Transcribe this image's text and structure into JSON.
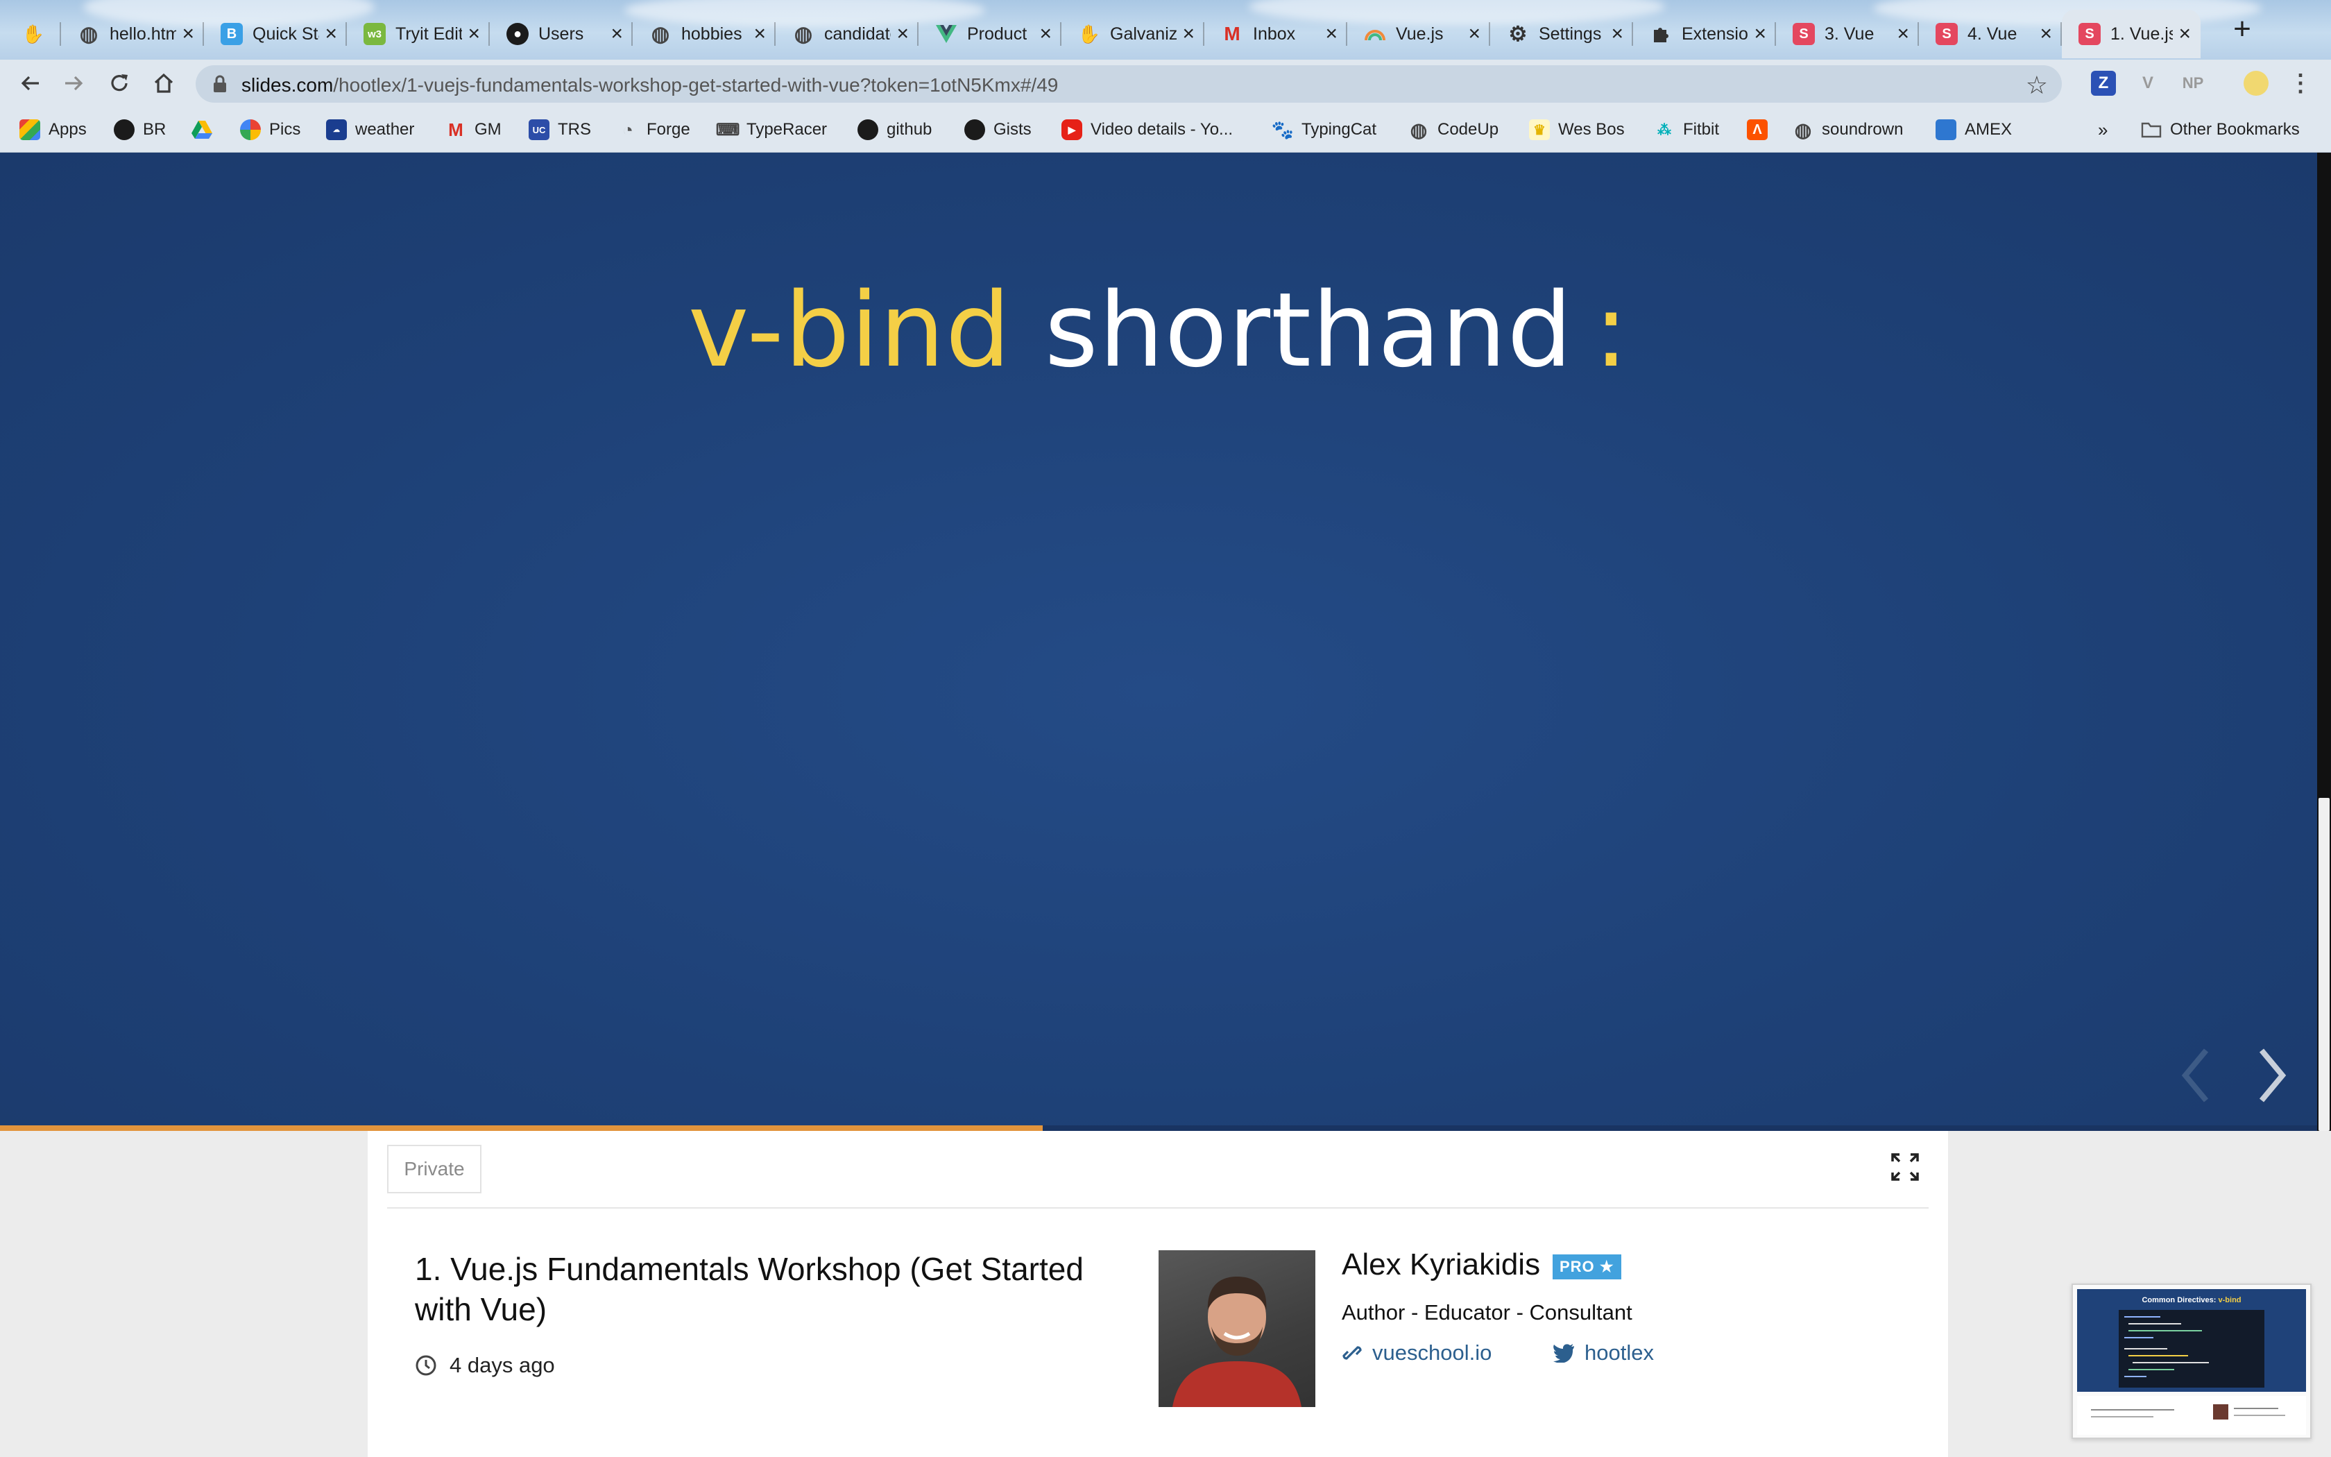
{
  "browser": {
    "tabs": [
      {
        "title": "",
        "icon": "galvanize-hand-icon",
        "color": "#e8a23c"
      },
      {
        "title": "hello.html",
        "icon": "globe-icon",
        "color": "#444444"
      },
      {
        "title": "Quick Start",
        "icon": "bootstrap-icon",
        "color": "#3aa0e6"
      },
      {
        "title": "Tryit Editor",
        "icon": "w3schools-icon",
        "color": "#7bb83f"
      },
      {
        "title": "Users",
        "icon": "github-icon",
        "color": "#1b1b1b"
      },
      {
        "title": "hobbies",
        "icon": "globe-icon",
        "color": "#444444"
      },
      {
        "title": "candidates",
        "icon": "globe-icon",
        "color": "#444444"
      },
      {
        "title": "Product",
        "icon": "vue-icon",
        "color": "#42b883"
      },
      {
        "title": "Galvanize",
        "icon": "galvanize-hand-icon",
        "color": "#e8a23c"
      },
      {
        "title": "Inbox",
        "icon": "gmail-icon",
        "color": "#d93025"
      },
      {
        "title": "Vue.js",
        "icon": "vue-rainbow-icon",
        "color": "#f08a3a"
      },
      {
        "title": "Settings",
        "icon": "gear-icon",
        "color": "#333333"
      },
      {
        "title": "Extensions",
        "icon": "puzzle-icon",
        "color": "#333333"
      },
      {
        "title": "3. Vue",
        "icon": "slides-icon",
        "color": "#e4475f"
      },
      {
        "title": "4. Vue",
        "icon": "slides-icon",
        "color": "#e4475f"
      },
      {
        "title": "1. Vue.js",
        "icon": "slides-icon",
        "color": "#e4475f",
        "active": true
      }
    ],
    "new_tab": "+",
    "url": {
      "host": "slides.com",
      "path": "/hootlex/1-vuejs-fundamentals-workshop-get-started-with-vue?token=1otN5Kmx#/49"
    },
    "extensions": [
      "Z",
      "V",
      "NP"
    ],
    "bookmarks": [
      {
        "label": "Apps",
        "icon": "apps-grid-icon"
      },
      {
        "label": "BR",
        "icon": "github-icon"
      },
      {
        "label": "",
        "icon": "google-drive-icon"
      },
      {
        "label": "Pics",
        "icon": "google-photos-icon"
      },
      {
        "label": "weather",
        "icon": "weather-icon"
      },
      {
        "label": "GM",
        "icon": "gmail-icon"
      },
      {
        "label": "TRS",
        "icon": "trs-icon"
      },
      {
        "label": "Forge",
        "icon": "forge-icon"
      },
      {
        "label": "TypeRacer",
        "icon": "typeracer-icon"
      },
      {
        "label": "github",
        "icon": "github-icon"
      },
      {
        "label": "Gists",
        "icon": "github-icon"
      },
      {
        "label": "Video details - Yo...",
        "icon": "youtube-icon"
      },
      {
        "label": "TypingCat",
        "icon": "paw-icon"
      },
      {
        "label": "CodeUp",
        "icon": "globe-icon"
      },
      {
        "label": "Wes Bos",
        "icon": "crown-icon"
      },
      {
        "label": "Fitbit",
        "icon": "fitbit-icon"
      },
      {
        "label": "",
        "icon": "strava-icon"
      },
      {
        "label": "soundrown",
        "icon": "globe-icon"
      },
      {
        "label": "AMEX",
        "icon": "amex-icon"
      }
    ],
    "more": "»",
    "other_bookmarks": "Other Bookmarks"
  },
  "slide": {
    "keyword": "v-bind",
    "rest": "shorthand",
    "colon": ":",
    "progress": 0.45,
    "colors": {
      "background": "#1e4177",
      "accent": "#f4cf46",
      "progress": "#e2943c"
    }
  },
  "deck": {
    "visibility": "Private",
    "title": "1. Vue.js Fundamentals Workshop (Get Started with Vue)",
    "time": "4 days ago",
    "author": {
      "name": "Alex Kyriakidis",
      "badge": "PRO",
      "description": "Author - Educator - Consultant",
      "website": "vueschool.io",
      "twitter": "hootlex"
    }
  },
  "preview": {
    "keyword": "Common Directives:",
    "highlight": "v-bind"
  }
}
